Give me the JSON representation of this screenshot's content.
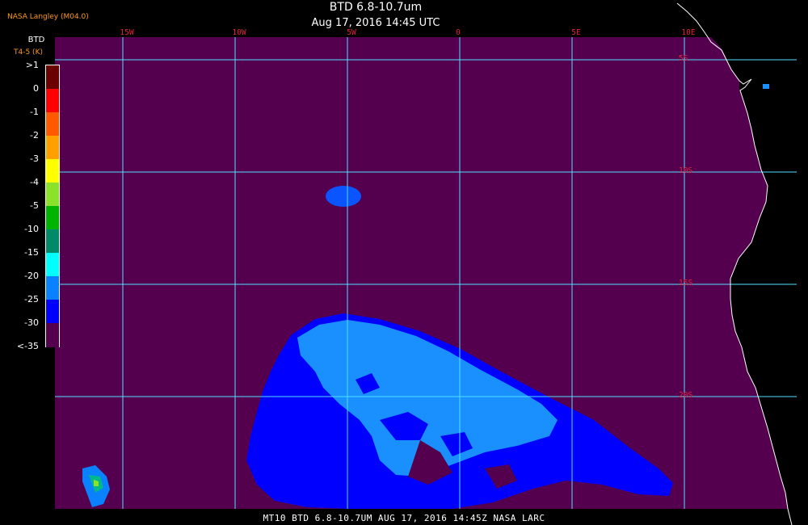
{
  "header": {
    "title": "BTD 6.8-10.7um",
    "subtitle": "Aug 17, 2016 14:45 UTC",
    "producer": "NASA Langley (M04.0)"
  },
  "footer": {
    "text": "MT10  BTD 6.8-10.7UM  AUG 17, 2016 14:45Z  NASA LARC"
  },
  "grid": {
    "longitudes": [
      "15W",
      "10W",
      "5W",
      "0",
      "5E",
      "10E"
    ],
    "latitudes": [
      "5S",
      "10S",
      "15S",
      "20S"
    ]
  },
  "legend": {
    "title": "BTD",
    "subtitle": "T4-5 (K)",
    "ticks": [
      ">1",
      "0",
      "-1",
      "-2",
      "-3",
      "-4",
      "-5",
      "-10",
      "-15",
      "-20",
      "-25",
      "-30",
      "<-35"
    ],
    "colors": [
      "#6b0000",
      "#ff0000",
      "#ff5a00",
      "#ffa000",
      "#ffff00",
      "#8ae22a",
      "#00b400",
      "#008a68",
      "#00ffff",
      "#0a82ff",
      "#0000ff",
      "#55004f"
    ]
  },
  "colors": {
    "background_ocean": "#55004f",
    "grid_lines": "#4fe0ff",
    "coastline": "#ffffff",
    "label_red": "#e0223a",
    "dust_blue": "#0000ff",
    "dust_light_blue": "#1a90ff"
  }
}
